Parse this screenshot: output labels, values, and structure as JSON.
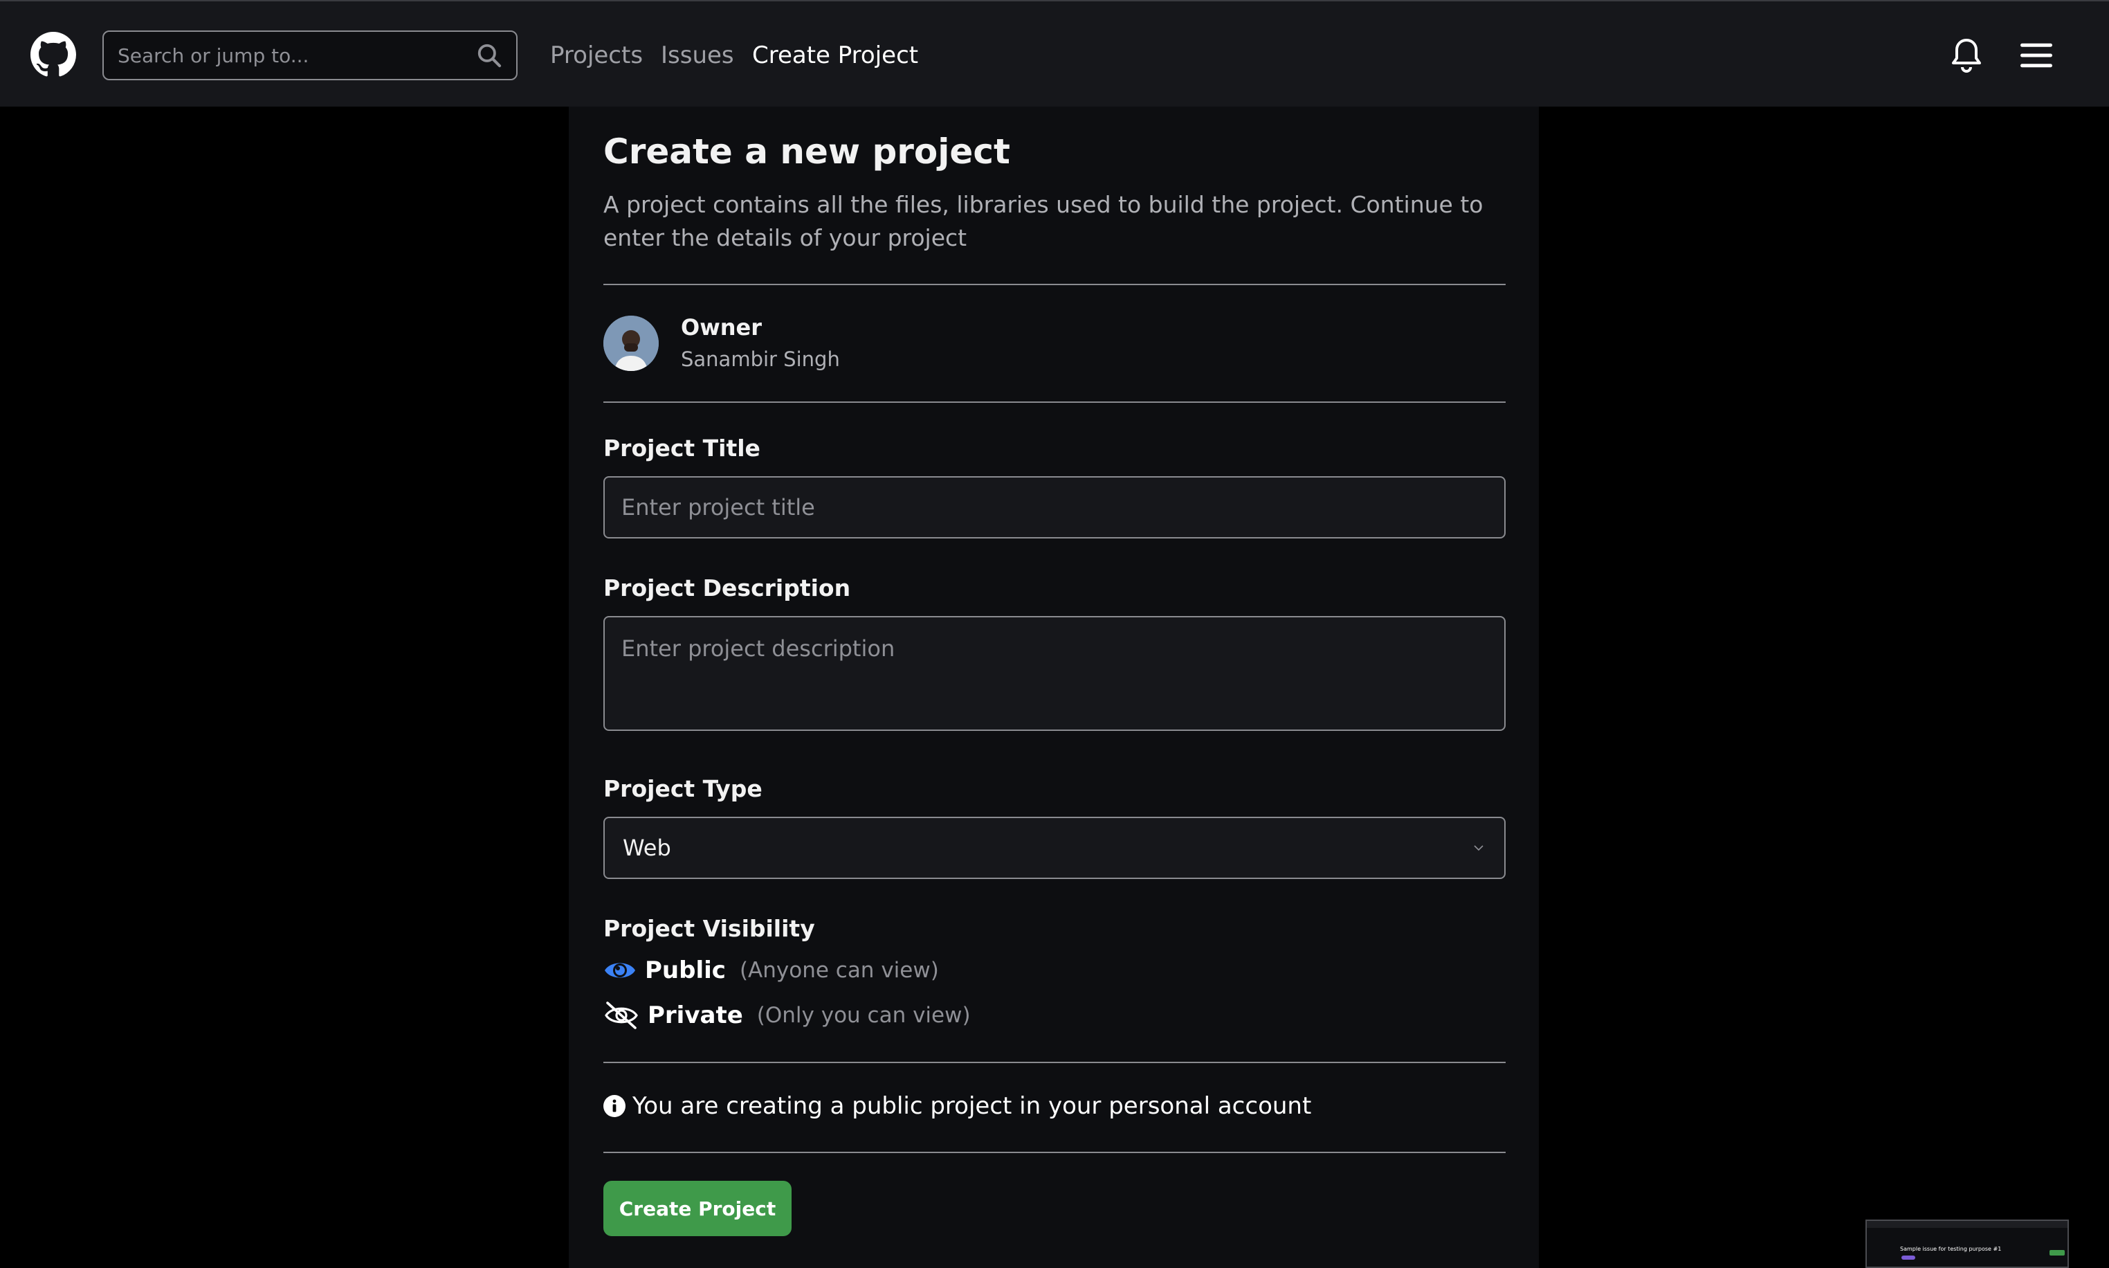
{
  "header": {
    "search_placeholder": "Search or jump to...",
    "nav": [
      "Projects",
      "Issues",
      "Create Project"
    ]
  },
  "page": {
    "title": "Create a new project",
    "description": "A project contains all the files, libraries used to build the project. Continue to enter the details of your project"
  },
  "owner": {
    "label": "Owner",
    "name": "Sanambir Singh"
  },
  "form": {
    "title_label": "Project Title",
    "title_placeholder": "Enter project title",
    "description_label": "Project Description",
    "description_placeholder": "Enter project description",
    "type_label": "Project Type",
    "type_value": "Web",
    "visibility_label": "Project Visibility",
    "visibility_options": [
      {
        "name": "Public",
        "hint": "(Anyone can view)",
        "selected": true
      },
      {
        "name": "Private",
        "hint": "(Only you can view)",
        "selected": false
      }
    ],
    "info_text": "You are creating a public project in your personal account",
    "submit_label": "Create Project"
  },
  "thumbnail": {
    "text": "Sample issue for testing purpose #1"
  },
  "colors": {
    "accent_blue": "#3b82f6",
    "button_green": "#3f9a4a"
  }
}
